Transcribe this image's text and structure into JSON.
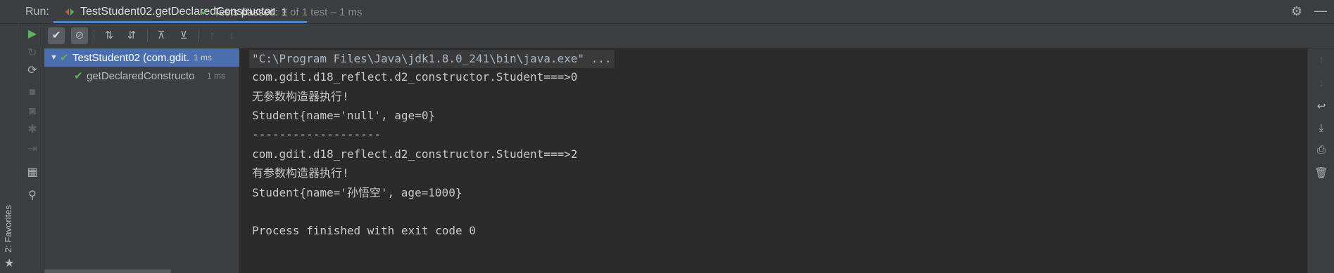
{
  "run_window": {
    "label": "Run:",
    "tab_title": "TestStudent02.getDeclaredConstructor",
    "tab_close": "×"
  },
  "favorites": {
    "label": "2: Favorites"
  },
  "status": {
    "main": "Tests passed: 1",
    "detail": " of 1 test – 1 ms"
  },
  "tree": {
    "items": [
      {
        "label": "TestStudent02 (com.gdit.",
        "time": "1 ms",
        "status": "passed",
        "expanded": true
      },
      {
        "label": "getDeclaredConstructo",
        "time": "1 ms",
        "status": "passed"
      }
    ]
  },
  "console": {
    "lines": [
      "\"C:\\Program Files\\Java\\jdk1.8.0_241\\bin\\java.exe\" ...",
      "com.gdit.d18_reflect.d2_constructor.Student===>0",
      "无参数构造器执行!",
      "Student{name='null', age=0}",
      "-------------------",
      "com.gdit.d18_reflect.d2_constructor.Student===>2",
      "有参数构造器执行!",
      "Student{name='孙悟空', age=1000}",
      "",
      "Process finished with exit code 0"
    ]
  },
  "colors": {
    "passed": "#5fb15b",
    "selection": "#4b6eaf",
    "tab_accent": "#4a88c7",
    "background": "#2b2b2b",
    "panel": "#3c3f41"
  },
  "icons": {
    "left_bar": [
      "run-icon",
      "rerun-failed-icon",
      "toggle-auto-test-icon",
      "stop-icon",
      "camera-icon",
      "debug-icon",
      "exit-icon",
      "layout-icon",
      "pin-icon"
    ],
    "toolbar": [
      "show-passed-icon",
      "show-ignored-icon",
      "sort-alphabetically-icon",
      "sort-by-duration-icon",
      "expand-all-icon",
      "collapse-all-icon",
      "previous-failed-icon",
      "next-failed-icon"
    ],
    "right_bar": [
      "scroll-up-icon",
      "scroll-down-icon",
      "soft-wrap-icon",
      "scroll-to-end-icon",
      "print-icon",
      "clear-all-icon"
    ]
  }
}
